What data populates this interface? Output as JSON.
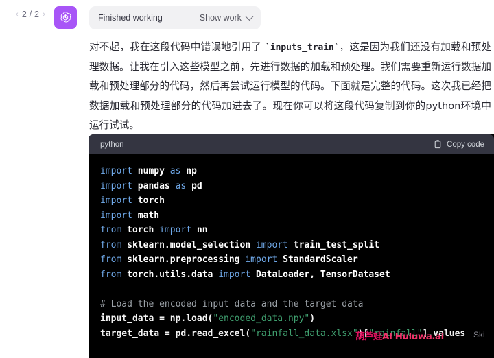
{
  "pager": {
    "prev_icon": "chevron-left-icon",
    "next_icon": "chevron-right-icon",
    "label": "2 / 2",
    "prev_glyph": "‹",
    "next_glyph": "›"
  },
  "avatar": {
    "icon": "openai-logo-icon",
    "background": "#a855f7"
  },
  "tool_pill": {
    "status": "Finished working",
    "show_work": "Show work",
    "chevron_icon": "chevron-down-icon",
    "background": "#f1f1f3"
  },
  "message": {
    "paragraph_before_code": "对不起，我在这段代码中错误地引用了 ",
    "inline_code": "`inputs_train`",
    "paragraph_after_code": "，这是因为我们还没有加载和预处理数据。让我在引入这些模型之前，先进行数据的加载和预处理。我们需要重新运行数据加载和预处理部分的代码，然后再尝试运行模型的代码。下面就是完整的代码。这次我已经把数据加载和预处理部分的代码加进去了。现在你可以将这段代码复制到你的python环境中运行试试。"
  },
  "code_block": {
    "language": "python",
    "copy_label": "Copy code",
    "copy_icon": "clipboard-icon",
    "lines": [
      {
        "tokens": [
          {
            "t": "import",
            "c": "kw"
          },
          {
            "t": " ",
            "c": "plain"
          },
          {
            "t": "numpy",
            "c": "nm"
          },
          {
            "t": " ",
            "c": "plain"
          },
          {
            "t": "as",
            "c": "kw"
          },
          {
            "t": " ",
            "c": "plain"
          },
          {
            "t": "np",
            "c": "nm"
          }
        ]
      },
      {
        "tokens": [
          {
            "t": "import",
            "c": "kw"
          },
          {
            "t": " ",
            "c": "plain"
          },
          {
            "t": "pandas",
            "c": "nm"
          },
          {
            "t": " ",
            "c": "plain"
          },
          {
            "t": "as",
            "c": "kw"
          },
          {
            "t": " ",
            "c": "plain"
          },
          {
            "t": "pd",
            "c": "nm"
          }
        ]
      },
      {
        "tokens": [
          {
            "t": "import",
            "c": "kw"
          },
          {
            "t": " ",
            "c": "plain"
          },
          {
            "t": "torch",
            "c": "nm"
          }
        ]
      },
      {
        "tokens": [
          {
            "t": "import",
            "c": "kw"
          },
          {
            "t": " ",
            "c": "plain"
          },
          {
            "t": "math",
            "c": "nm"
          }
        ]
      },
      {
        "tokens": [
          {
            "t": "from",
            "c": "kw"
          },
          {
            "t": " ",
            "c": "plain"
          },
          {
            "t": "torch",
            "c": "nm"
          },
          {
            "t": " ",
            "c": "plain"
          },
          {
            "t": "import",
            "c": "kw"
          },
          {
            "t": " ",
            "c": "plain"
          },
          {
            "t": "nn",
            "c": "nm"
          }
        ]
      },
      {
        "tokens": [
          {
            "t": "from",
            "c": "kw"
          },
          {
            "t": " ",
            "c": "plain"
          },
          {
            "t": "sklearn.model_selection",
            "c": "nm"
          },
          {
            "t": " ",
            "c": "plain"
          },
          {
            "t": "import",
            "c": "kw"
          },
          {
            "t": " ",
            "c": "plain"
          },
          {
            "t": "train_test_split",
            "c": "nm"
          }
        ]
      },
      {
        "tokens": [
          {
            "t": "from",
            "c": "kw"
          },
          {
            "t": " ",
            "c": "plain"
          },
          {
            "t": "sklearn.preprocessing",
            "c": "nm"
          },
          {
            "t": " ",
            "c": "plain"
          },
          {
            "t": "import",
            "c": "kw"
          },
          {
            "t": " ",
            "c": "plain"
          },
          {
            "t": "StandardScaler",
            "c": "nm"
          }
        ]
      },
      {
        "tokens": [
          {
            "t": "from",
            "c": "kw"
          },
          {
            "t": " ",
            "c": "plain"
          },
          {
            "t": "torch.utils.data",
            "c": "nm"
          },
          {
            "t": " ",
            "c": "plain"
          },
          {
            "t": "import",
            "c": "kw"
          },
          {
            "t": " ",
            "c": "plain"
          },
          {
            "t": "DataLoader, TensorDataset",
            "c": "nm"
          }
        ]
      },
      {
        "tokens": []
      },
      {
        "tokens": [
          {
            "t": "# Load the encoded input data and the target data",
            "c": "cmt"
          }
        ]
      },
      {
        "tokens": [
          {
            "t": "input_data = np.load(",
            "c": "op"
          },
          {
            "t": "\"encoded_data.npy\"",
            "c": "str"
          },
          {
            "t": ")",
            "c": "op"
          }
        ]
      },
      {
        "tokens": [
          {
            "t": "target_data = pd.read_excel(",
            "c": "op"
          },
          {
            "t": "\"rainfall_data.xlsx\"",
            "c": "str"
          },
          {
            "t": ")[",
            "c": "op"
          },
          {
            "t": "\"rainfall\"",
            "c": "str"
          },
          {
            "t": "].values",
            "c": "op"
          }
        ]
      }
    ]
  },
  "watermark": {
    "cn": "葫芦娃",
    "latin": "AI Huluwa.ai",
    "tail": "Ski",
    "color": "#e0115f"
  }
}
